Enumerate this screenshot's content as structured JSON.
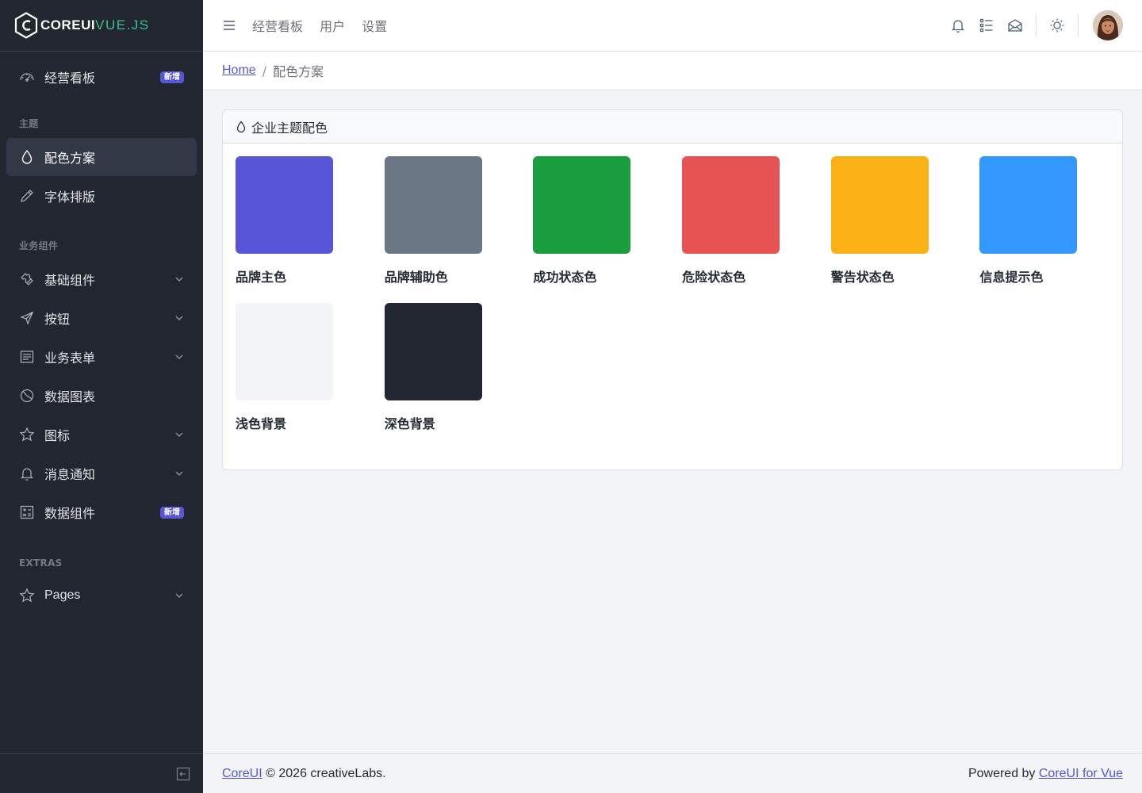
{
  "brand": {
    "core": "COREUI",
    "suffix": "VUE.JS"
  },
  "sidebar": {
    "dashboard": {
      "label": "经营看板",
      "badge": "新增",
      "icon": "speedometer-icon"
    },
    "section_theme": "主题",
    "colors": {
      "label": "配色方案",
      "icon": "drop-icon"
    },
    "typography": {
      "label": "字体排版",
      "icon": "pencil-icon"
    },
    "section_components": "业务组件",
    "base": {
      "label": "基础组件",
      "icon": "puzzle-icon"
    },
    "buttons": {
      "label": "按钮",
      "icon": "cursor-icon"
    },
    "forms": {
      "label": "业务表单",
      "icon": "notes-icon"
    },
    "charts": {
      "label": "数据图表",
      "icon": "chart-pie-icon"
    },
    "icons": {
      "label": "图标",
      "icon": "star-icon"
    },
    "notifications": {
      "label": "消息通知",
      "icon": "bell-icon"
    },
    "widgets": {
      "label": "数据组件",
      "badge": "新增",
      "icon": "calculator-icon"
    },
    "section_extras": "EXTRAS",
    "pages": {
      "label": "Pages",
      "icon": "star-icon"
    }
  },
  "header": {
    "nav": [
      "经营看板",
      "用户",
      "设置"
    ],
    "icons": [
      "bell-icon",
      "list-icon",
      "envelope-open-icon",
      "sun-icon"
    ]
  },
  "breadcrumb": {
    "home": "Home",
    "current": "配色方案"
  },
  "card": {
    "title": "企业主题配色",
    "colors": [
      {
        "label": "品牌主色",
        "hex": "#5856d6"
      },
      {
        "label": "品牌辅助色",
        "hex": "#6b7785"
      },
      {
        "label": "成功状态色",
        "hex": "#1b9e3e"
      },
      {
        "label": "危险状态色",
        "hex": "#e55353"
      },
      {
        "label": "警告状态色",
        "hex": "#f9b115"
      },
      {
        "label": "信息提示色",
        "hex": "#3399ff"
      },
      {
        "label": "浅色背景",
        "hex": "#f3f4f7"
      },
      {
        "label": "深色背景",
        "hex": "#212631"
      }
    ]
  },
  "footer": {
    "left_link": "CoreUI",
    "left_text": " © 2026 creativeLabs.",
    "right_text": "Powered by ",
    "right_link": "CoreUI for Vue"
  }
}
